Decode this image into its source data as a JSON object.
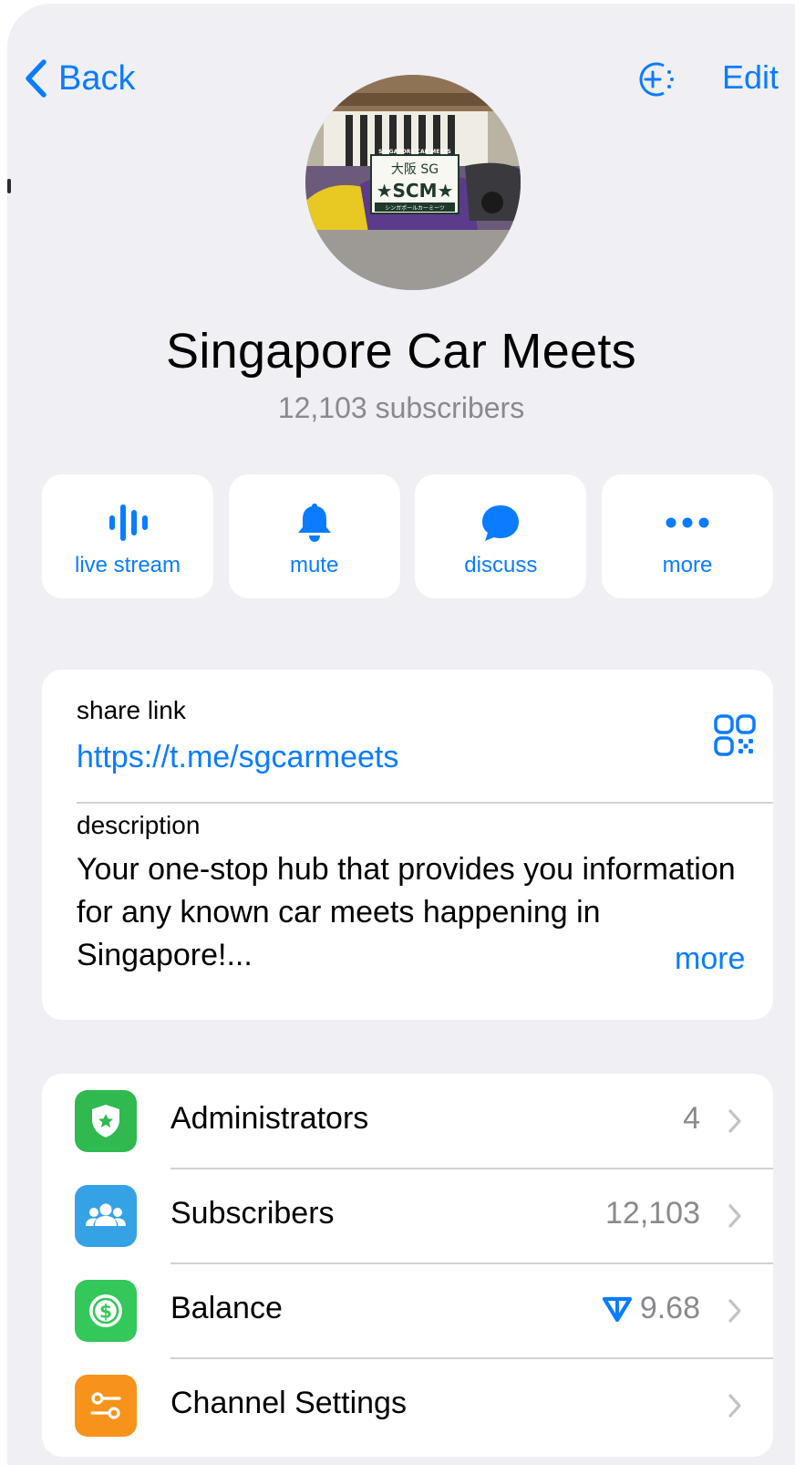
{
  "nav": {
    "back_label": "Back",
    "edit_label": "Edit"
  },
  "channel": {
    "name": "Singapore Car Meets",
    "subscribers_text": "12,103 subscribers",
    "avatar_plate_line1": "大阪 SG",
    "avatar_plate_line2": "★SCM★",
    "avatar_banner": "SINGAPORE CAR MEETS",
    "avatar_plate_sub": "シンガポールカーミーツ"
  },
  "actions": [
    {
      "label": "live stream",
      "icon": "live-stream-icon"
    },
    {
      "label": "mute",
      "icon": "bell-icon"
    },
    {
      "label": "discuss",
      "icon": "speech-bubble-icon"
    },
    {
      "label": "more",
      "icon": "ellipsis-icon"
    }
  ],
  "info": {
    "share_label": "share link",
    "share_url": "https://t.me/sgcarmeets",
    "description_label": "description",
    "description_text": "Your one-stop hub that provides you information for any known car meets happening in Singapore!...",
    "more_label": "more"
  },
  "settings": [
    {
      "label": "Administrators",
      "value": "4",
      "icon": "shield-star-icon",
      "color": "#2fb94f"
    },
    {
      "label": "Subscribers",
      "value": "12,103",
      "icon": "people-icon",
      "color": "#36a2e6"
    },
    {
      "label": "Balance",
      "value": "9.68",
      "icon": "dollar-coin-icon",
      "color": "#34c759",
      "currency_icon": "ton-icon"
    },
    {
      "label": "Channel Settings",
      "value": "",
      "icon": "toggles-icon",
      "color": "#f7931a"
    }
  ],
  "colors": {
    "accent": "#0a7cff",
    "background": "#efeff4",
    "secondary_text": "#8a8a8e"
  }
}
